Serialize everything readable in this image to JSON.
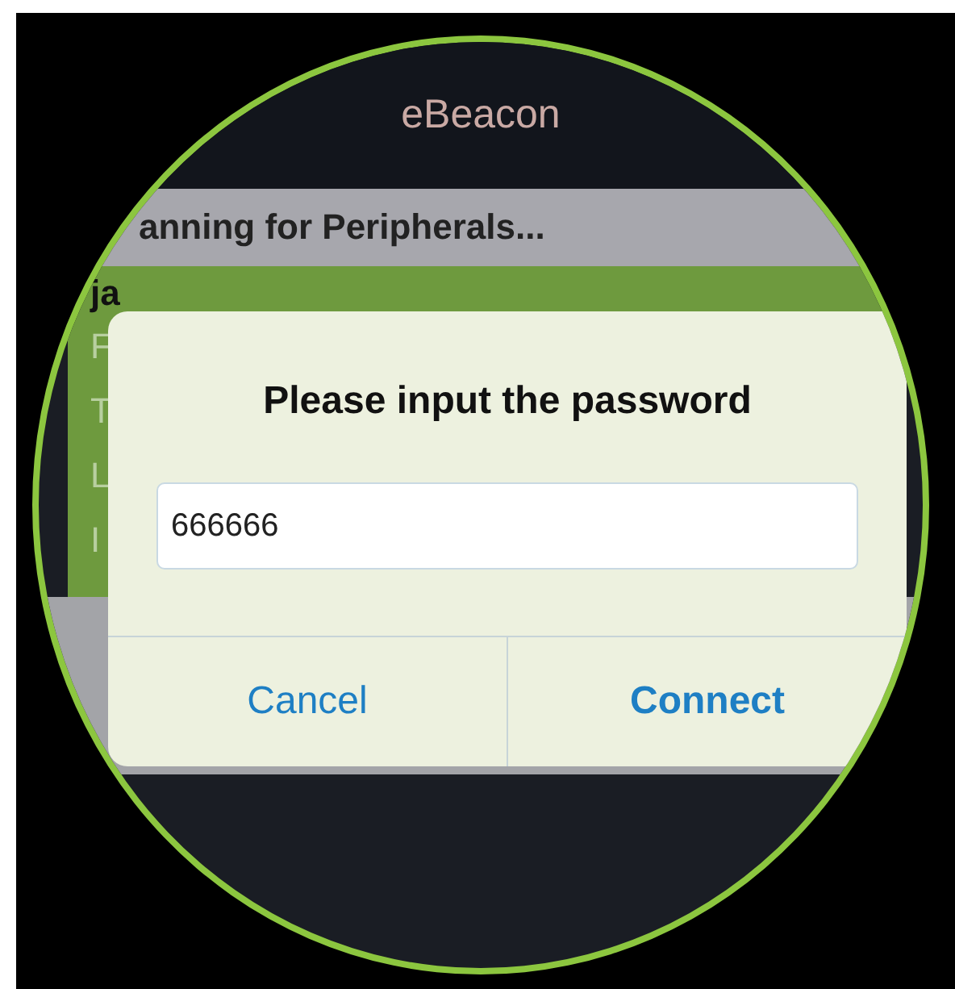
{
  "nav_bar": {
    "title": "eBeacon"
  },
  "status_header": {
    "text": "anning for Peripherals..."
  },
  "device_cell": {
    "name": "ja",
    "detail_rows": [
      "F",
      "T",
      "L",
      "I"
    ]
  },
  "alert": {
    "title": "Please input the password",
    "field": {
      "value": "666666"
    },
    "buttons": [
      {
        "label": "Cancel",
        "kind": "cancel"
      },
      {
        "label": "Connect",
        "kind": "default"
      }
    ]
  }
}
